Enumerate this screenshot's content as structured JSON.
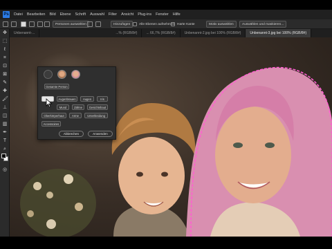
{
  "menubar": {
    "logo": "Ps",
    "items": [
      "Datei",
      "Bearbeiten",
      "Bild",
      "Ebene",
      "Schrift",
      "Auswahl",
      "Filter",
      "Ansicht",
      "Plug-ins",
      "Fenster",
      "Hilfe"
    ]
  },
  "options": {
    "select_people": "Personen auswählen",
    "mode": "Hinzufügen",
    "all_layers": "Alle Ebenen aufnehmen",
    "hard_edge": "Harte Kante",
    "select_subject": "Motiv auswählen",
    "select_and_mask": "Auswählen und maskieren..."
  },
  "tabs": [
    "Unbenannt-...",
    "...% (RGB/8#)",
    "... 66,7% (RGB/8#)",
    "Unbenannt-2.jpg bei 100% (RGB/8#)",
    "Unbenannt-3.jpg bei 100% (RGB/8#)"
  ],
  "popup": {
    "whole_person": "Gesamte Person",
    "chips_row1": [
      "Augenbrauen",
      "Augen",
      "Iris"
    ],
    "chips_row2": [
      "Mund",
      "Zähne",
      "Gesichtshaut"
    ],
    "chips_row3": [
      "Oberkörperhaut",
      "Arme",
      "Unterkleidung"
    ],
    "chips_row4": [
      "Accessoires"
    ],
    "cancel": "Abbrechen",
    "apply": "Anwenden"
  },
  "colors": {
    "selection_outline": "#ff5fd0",
    "ui_panel": "#2f2f2f",
    "menubar_bg": "#202020"
  }
}
